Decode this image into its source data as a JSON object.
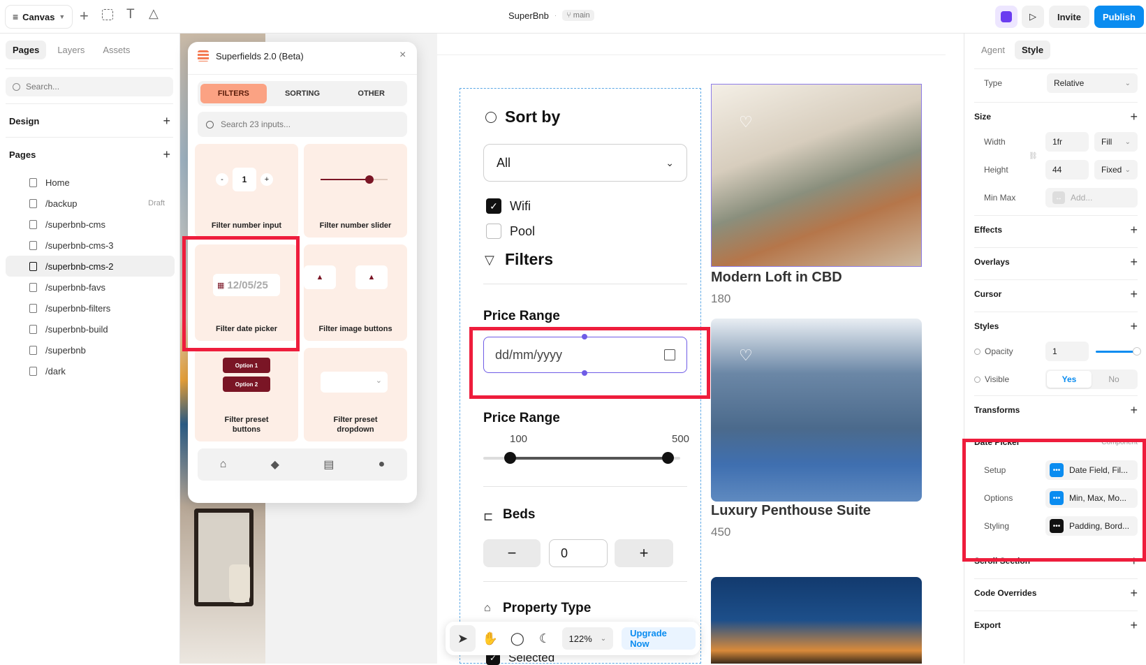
{
  "topbar": {
    "app_menu": "Canvas",
    "project_title": "SuperBnb",
    "branch": "main",
    "invite_label": "Invite",
    "publish_label": "Publish"
  },
  "left": {
    "tabs": [
      "Pages",
      "Layers",
      "Assets"
    ],
    "search_placeholder": "Search...",
    "design_label": "Design",
    "pages_label": "Pages",
    "pages": [
      {
        "name": "Home",
        "badge": ""
      },
      {
        "name": "/backup",
        "badge": "Draft"
      },
      {
        "name": "/superbnb-cms",
        "badge": ""
      },
      {
        "name": "/superbnb-cms-3",
        "badge": ""
      },
      {
        "name": "/superbnb-cms-2",
        "badge": ""
      },
      {
        "name": "/superbnb-favs",
        "badge": ""
      },
      {
        "name": "/superbnb-filters",
        "badge": ""
      },
      {
        "name": "/superbnb-build",
        "badge": ""
      },
      {
        "name": "/superbnb",
        "badge": ""
      },
      {
        "name": "/dark",
        "badge": ""
      }
    ]
  },
  "plugin": {
    "title": "Superfields 2.0 (Beta)",
    "tabs": [
      "FILTERS",
      "SORTING",
      "OTHER"
    ],
    "search_placeholder": "Search 23 inputs...",
    "stepper_value": "1",
    "stepper_minus": "-",
    "stepper_plus": "+",
    "date_value": "12/05/25",
    "option1": "Option 1",
    "option2": "Option 2",
    "cards": [
      "Filter number input",
      "Filter number slider",
      "Filter date picker",
      "Filter image buttons",
      "Filter preset buttons",
      "Filter preset dropdown"
    ]
  },
  "frame": {
    "sort_by": "Sort by",
    "sort_value": "All",
    "wifi": "Wifi",
    "pool": "Pool",
    "filters": "Filters",
    "price_range": "Price Range",
    "date_placeholder": "dd/mm/yyyy",
    "price_range2": "Price Range",
    "price_min": "100",
    "price_max": "500",
    "price_range_low": 100,
    "price_range_high": 500,
    "beds": "Beds",
    "beds_value": "0",
    "beds_minus": "−",
    "beds_plus": "+",
    "property_type": "Property Type",
    "selected": "Selected",
    "listings": [
      {
        "title": "Modern Loft in CBD",
        "price": "180"
      },
      {
        "title": "Luxury Penthouse Suite",
        "price": "450"
      }
    ]
  },
  "toolbar": {
    "zoom": "122%",
    "upgrade": "Upgrade Now"
  },
  "right": {
    "tabs": [
      "Agent",
      "Style"
    ],
    "type_label": "Type",
    "type_value": "Relative",
    "size_label": "Size",
    "width_label": "Width",
    "width_value": "1fr",
    "width_mode": "Fill",
    "height_label": "Height",
    "height_value": "44",
    "height_mode": "Fixed",
    "minmax_label": "Min Max",
    "minmax_placeholder": "Add...",
    "effects": "Effects",
    "overlays": "Overlays",
    "cursor": "Cursor",
    "styles": "Styles",
    "opacity_label": "Opacity",
    "opacity_value": "1",
    "visible_label": "Visible",
    "visible_yes": "Yes",
    "visible_no": "No",
    "transforms": "Transforms",
    "date_picker": "Date Picker",
    "component": "Component",
    "setup_label": "Setup",
    "setup_value": "Date Field, Fil...",
    "options_label": "Options",
    "options_value": "Min, Max, Mo...",
    "styling_label": "Styling",
    "styling_value": "Padding, Bord...",
    "scroll_section": "Scroll Section",
    "code_overrides": "Code Overrides",
    "export": "Export"
  },
  "colors": {
    "accent_blue": "#0a8cf0",
    "highlight_red": "#ee1d3c",
    "plugin_accent": "#fba283",
    "option_maroon": "#7a1525"
  }
}
